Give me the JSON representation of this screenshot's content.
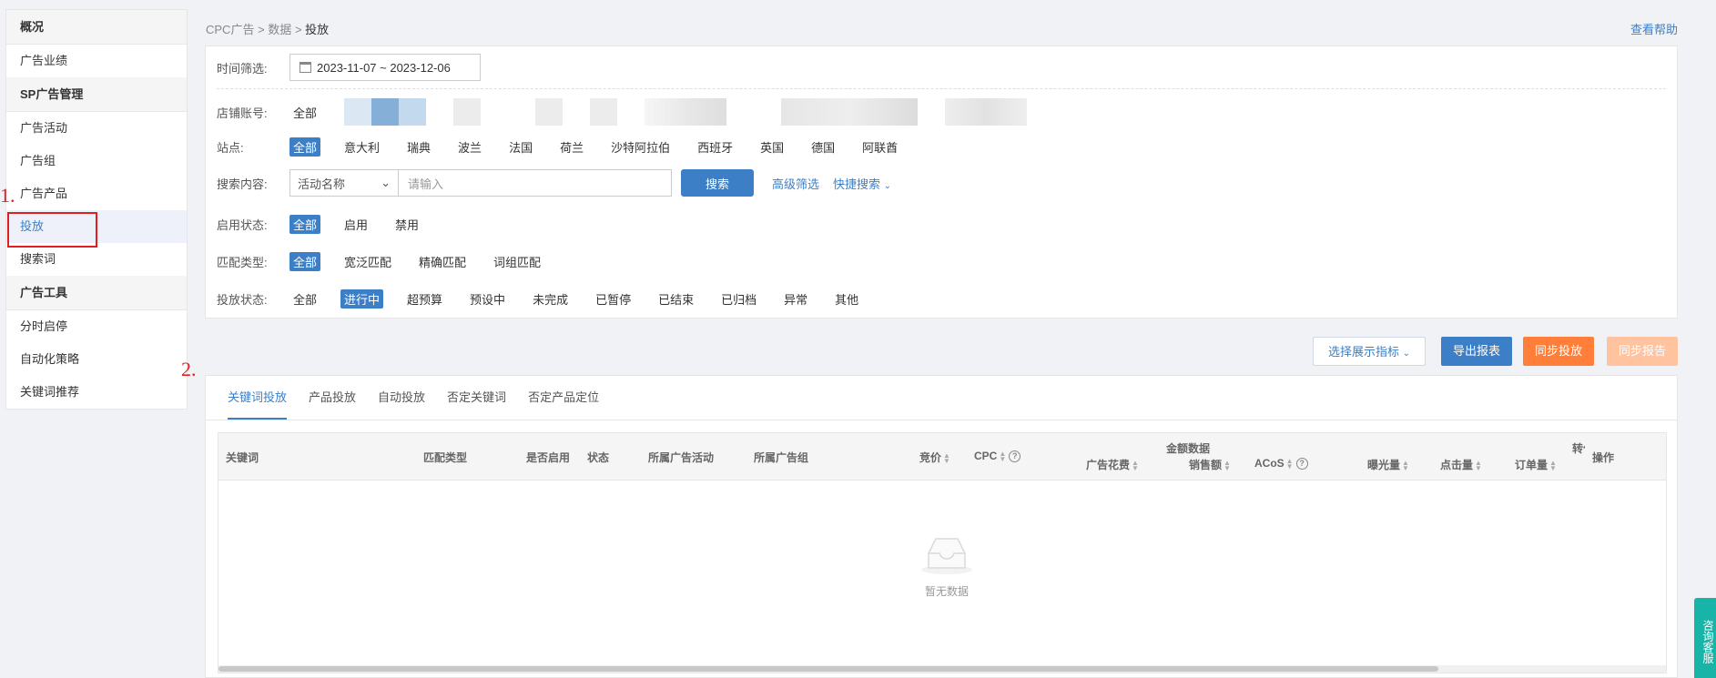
{
  "sidebar": {
    "groups": [
      {
        "title": "概况",
        "items": [
          "广告业绩"
        ]
      },
      {
        "title": "SP广告管理",
        "items": [
          "广告活动",
          "广告组",
          "广告产品",
          "投放",
          "搜索词"
        ]
      },
      {
        "title": "广告工具",
        "items": [
          "分时启停",
          "自动化策略",
          "关键词推荐"
        ]
      }
    ],
    "active_item": "投放"
  },
  "annotations": {
    "first": "1.",
    "second": "2."
  },
  "breadcrumb": {
    "part1": "CPC广告",
    "sep": ">",
    "part2": "数据",
    "current": "投放"
  },
  "help_link": "查看帮助",
  "filters": {
    "time_label": "时间筛选:",
    "date_range": "2023-11-07 ~ 2023-12-06",
    "store_label": "店铺账号:",
    "store_all": "全部",
    "site_label": "站点:",
    "sites": [
      "全部",
      "意大利",
      "瑞典",
      "波兰",
      "法国",
      "荷兰",
      "沙特阿拉伯",
      "西班牙",
      "英国",
      "德国",
      "阿联酋"
    ],
    "search_label": "搜索内容:",
    "search_field": "活动名称",
    "search_placeholder": "请输入",
    "search_button": "搜索",
    "advanced_filter": "高级筛选",
    "quick_search": "快捷搜索",
    "enable_label": "启用状态:",
    "enable_options": [
      "全部",
      "启用",
      "禁用"
    ],
    "match_label": "匹配类型:",
    "match_options": [
      "全部",
      "宽泛匹配",
      "精确匹配",
      "词组匹配"
    ],
    "status_label": "投放状态:",
    "status_options": [
      "全部",
      "进行中",
      "超预算",
      "预设中",
      "未完成",
      "已暂停",
      "已结束",
      "已归档",
      "异常",
      "其他"
    ]
  },
  "toolbar": {
    "select_metrics": "选择展示指标",
    "export": "导出报表",
    "sync_targeting": "同步投放",
    "sync_report": "同步报告"
  },
  "tabs": [
    "关键词投放",
    "产品投放",
    "自动投放",
    "否定关键词",
    "否定产品定位"
  ],
  "table": {
    "headers": {
      "keyword": "关键词",
      "match_type": "匹配类型",
      "enabled": "是否启用",
      "status": "状态",
      "campaign": "所属广告活动",
      "ad_group": "所属广告组",
      "bid": "竞价",
      "cpc": "CPC",
      "amount_group": "金额数据",
      "spend": "广告花费",
      "sales": "销售额",
      "acos": "ACoS",
      "impressions": "曝光量",
      "clicks": "点击量",
      "orders": "订单量",
      "conversion_partial": "转化",
      "actions": "操作"
    },
    "empty_text": "暂无数据"
  },
  "service_button": "咨询客服",
  "colors": {
    "primary": "#3d7fc7",
    "orange": "#ff7f3a",
    "orange_light": "#ffc3a0",
    "annotation": "#e02020"
  }
}
